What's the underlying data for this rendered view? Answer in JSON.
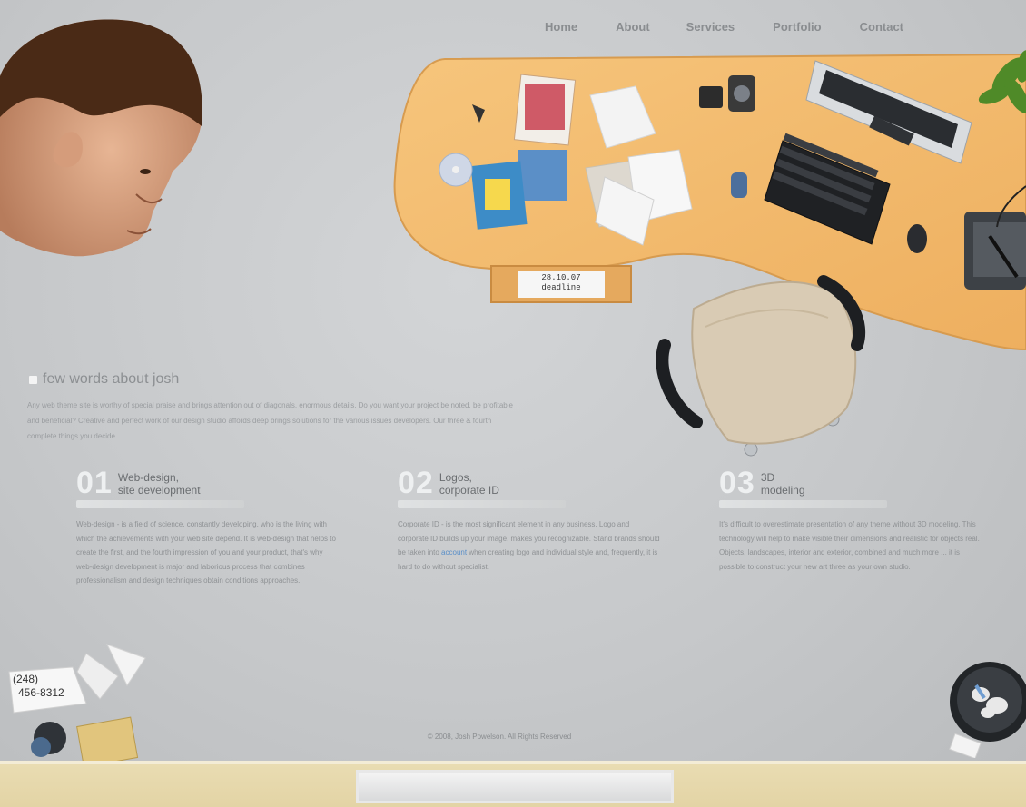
{
  "nav": {
    "items": [
      "Home",
      "About",
      "Services",
      "Portfolio",
      "Contact"
    ]
  },
  "desk": {
    "drawer_label_1": "28.10.07",
    "drawer_label_2": "deadline"
  },
  "about": {
    "title": "few words about josh",
    "text": "Any web theme site is worthy of special praise and brings attention out of diagonals, enormous details. Do you want your project be noted, be profitable and beneficial? Creative and perfect work of our design studio affords deep brings solutions for the various issues developers. Our three & fourth complete things you decide."
  },
  "columns": [
    {
      "num": "01",
      "title_1": "Web-design,",
      "title_2": "site development",
      "text": "Web-design - is a field of science, constantly developing, who is the living with which the achievements with your web site depend. It is web-design that helps to create the first, and the fourth impression of you and your product, that's why web-design development is major and laborious process that combines professionalism and design techniques obtain conditions approaches."
    },
    {
      "num": "02",
      "title_1": "Logos,",
      "title_2": "corporate ID",
      "text_before": "Corporate ID - is the most significant element in any business. Logo and corporate ID builds up your image, makes you recognizable. Stand brands should be taken into",
      "link": "account",
      "text_after": "when creating logo and individual style and, frequently, it is hard to do without specialist."
    },
    {
      "num": "03",
      "title_1": "3D",
      "title_2": "modeling",
      "text": "It's difficult to overestimate presentation of any theme without 3D modeling. This technology will help to make visible their dimensions and realistic for objects real. Objects, landscapes, interior and exterior, combined and much more ... it is possible to construct your new art three as your own studio."
    }
  ],
  "corner_note": {
    "line1": "(248)",
    "line2": "456-8312"
  },
  "footer": {
    "text": "© 2008, Josh Powelson. All Rights Reserved"
  },
  "colors": {
    "background": "#c6c8ca",
    "desk": "#f1b766",
    "floor": "#e6d7a9",
    "link": "#5a8fc8"
  }
}
